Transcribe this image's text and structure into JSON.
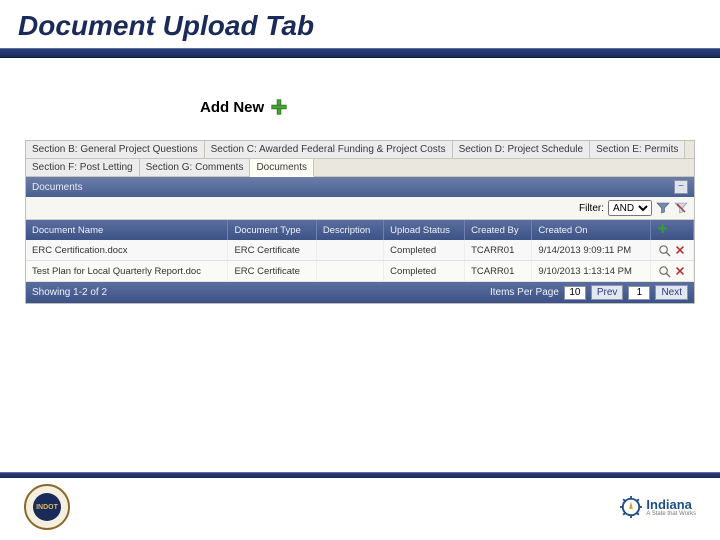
{
  "slide": {
    "title": "Document Upload Tab"
  },
  "add_new": {
    "label": "Add New"
  },
  "tabs_row1": [
    {
      "label": "Section B: General Project Questions"
    },
    {
      "label": "Section C: Awarded Federal Funding & Project Costs"
    },
    {
      "label": "Section D: Project Schedule"
    },
    {
      "label": "Section E: Permits"
    }
  ],
  "tabs_row2": [
    {
      "label": "Section F: Post Letting"
    },
    {
      "label": "Section G: Comments"
    },
    {
      "label": "Documents",
      "active": true
    }
  ],
  "section": {
    "title": "Documents"
  },
  "filter": {
    "label": "Filter:",
    "mode": "AND"
  },
  "grid": {
    "columns": [
      "Document Name",
      "Document Type",
      "Description",
      "Upload Status",
      "Created By",
      "Created On"
    ],
    "rows": [
      {
        "name": "ERC Certification.docx",
        "type": "ERC Certificate",
        "desc": "",
        "status": "Completed",
        "by": "TCARR01",
        "on": "9/14/2013 9:09:11 PM"
      },
      {
        "name": "Test Plan for Local Quarterly Report.doc",
        "type": "ERC Certificate",
        "desc": "",
        "status": "Completed",
        "by": "TCARR01",
        "on": "9/10/2013 1:13:14 PM"
      }
    ]
  },
  "pager": {
    "showing": "Showing 1-2 of 2",
    "items_label": "Items Per Page",
    "items_value": "10",
    "prev": "Prev",
    "page": "1",
    "next": "Next"
  },
  "brand": {
    "name": "Indiana",
    "tag": "A State that Works",
    "seal": "INDOT"
  }
}
